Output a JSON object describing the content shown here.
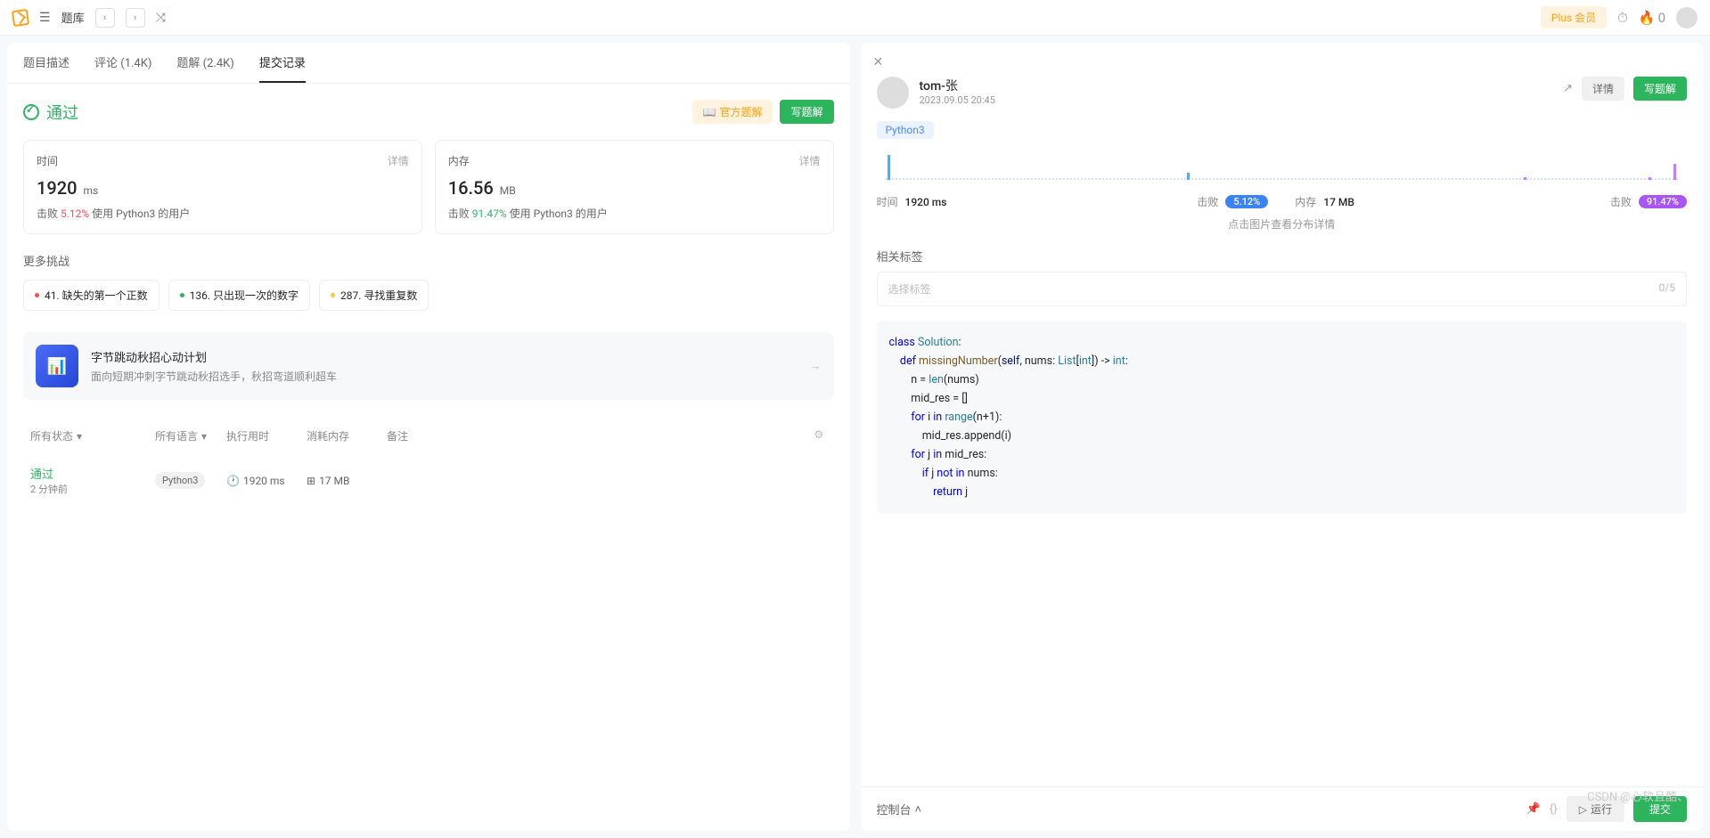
{
  "topbar": {
    "breadcrumb": "题库",
    "plus": "Plus 会员",
    "fire_count": "0"
  },
  "tabs": [
    {
      "label": "题目描述"
    },
    {
      "label": "评论 (1.4K)"
    },
    {
      "label": "题解 (2.4K)"
    },
    {
      "label": "提交记录",
      "active": true
    }
  ],
  "status": {
    "text": "通过",
    "official": "官方题解",
    "write": "写题解"
  },
  "stats": {
    "time": {
      "label": "时间",
      "detail": "详情",
      "value": "1920",
      "unit": "ms",
      "beat_label": "击败",
      "beat_pct": "5.12%",
      "beat_rest": "使用 Python3 的用户",
      "color": "red"
    },
    "mem": {
      "label": "内存",
      "detail": "详情",
      "value": "16.56",
      "unit": "MB",
      "beat_label": "击败",
      "beat_pct": "91.47%",
      "beat_rest": "使用 Python3 的用户",
      "color": "green"
    }
  },
  "more": {
    "title": "更多挑战",
    "items": [
      {
        "dot": "r",
        "text": "41. 缺失的第一个正数"
      },
      {
        "dot": "g",
        "text": "136. 只出现一次的数字"
      },
      {
        "dot": "y",
        "text": "287. 寻找重复数"
      }
    ]
  },
  "promo": {
    "title": "字节跳动秋招心动计划",
    "sub": "面向短期冲刺字节跳动秋招选手，秋招弯道顺利超车"
  },
  "table": {
    "headers": {
      "status": "所有状态",
      "lang": "所有语言",
      "runtime": "执行用时",
      "memory": "消耗内存",
      "notes": "备注"
    },
    "row": {
      "status": "通过",
      "ago": "2 分钟前",
      "lang": "Python3",
      "runtime": "1920 ms",
      "memory": "17 MB"
    }
  },
  "right": {
    "user": "tom-张",
    "date": "2023.09.05 20:45",
    "detail": "详情",
    "write": "写题解",
    "lang": "Python3",
    "dist": {
      "time_k": "时间",
      "time_v": "1920 ms",
      "time_beat": "击败",
      "time_pct": "5.12%",
      "mem_k": "内存",
      "mem_v": "17 MB",
      "mem_beat": "击败",
      "mem_pct": "91.47%",
      "hint": "点击图片查看分布详情"
    },
    "tags": {
      "label": "相关标签",
      "placeholder": "选择标签",
      "count": "0/5"
    },
    "code_tokens": [
      {
        "t": "class ",
        "c": "kw"
      },
      {
        "t": "Solution",
        "c": "cls"
      },
      {
        "t": ":\n"
      },
      {
        "t": "    def ",
        "c": "kw"
      },
      {
        "t": "missingNumber",
        "c": "fn"
      },
      {
        "t": "("
      },
      {
        "t": "self",
        "c": "param"
      },
      {
        "t": ", nums: "
      },
      {
        "t": "List",
        "c": "bi"
      },
      {
        "t": "["
      },
      {
        "t": "int",
        "c": "bi"
      },
      {
        "t": "]) -> "
      },
      {
        "t": "int",
        "c": "bi"
      },
      {
        "t": ":\n"
      },
      {
        "t": "        n = "
      },
      {
        "t": "len",
        "c": "bi"
      },
      {
        "t": "(nums)\n"
      },
      {
        "t": "        mid_res = []\n"
      },
      {
        "t": "        for ",
        "c": "kw"
      },
      {
        "t": "i "
      },
      {
        "t": "in ",
        "c": "kw"
      },
      {
        "t": "range",
        "c": "bi"
      },
      {
        "t": "(n+"
      },
      {
        "t": "1"
      },
      {
        "t": "):\n"
      },
      {
        "t": "            mid_res.append(i)\n"
      },
      {
        "t": "        for ",
        "c": "kw"
      },
      {
        "t": "j "
      },
      {
        "t": "in ",
        "c": "kw"
      },
      {
        "t": "mid_res:\n"
      },
      {
        "t": "            if ",
        "c": "kw"
      },
      {
        "t": "j "
      },
      {
        "t": "not in ",
        "c": "kw"
      },
      {
        "t": "nums:\n"
      },
      {
        "t": "                return ",
        "c": "kw"
      },
      {
        "t": "j\n"
      }
    ],
    "footer": {
      "console": "控制台",
      "run": "运行",
      "submit": "提交"
    }
  },
  "watermark": "CSDN @心软且酷、"
}
